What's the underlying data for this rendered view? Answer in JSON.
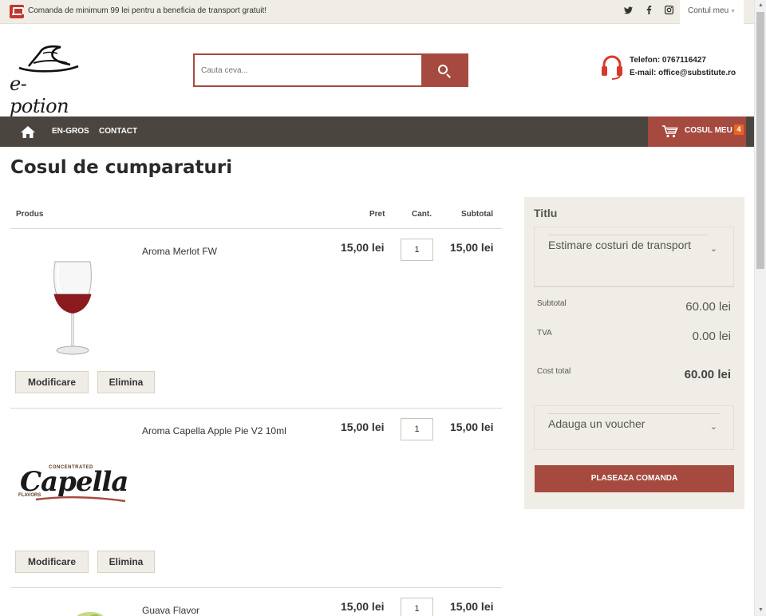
{
  "topbar": {
    "promo": "Comanda de minimum 99 lei pentru a beneficia de transport gratuit!",
    "social_icons": [
      "twitter-icon",
      "facebook-icon",
      "instagram-icon"
    ],
    "account_label": "Contul meu"
  },
  "header": {
    "logo_text": "e-potion",
    "search_placeholder": "Cauta ceva...",
    "phone_label": "Telefon: 0767116427",
    "email_label": "E-mail: office@substitute.ro"
  },
  "nav": {
    "items": [
      "EN-GROS",
      "CONTACT"
    ],
    "cart_label": "COSUL MEU",
    "cart_count": "4"
  },
  "page_title": "Cosul de cumparaturi",
  "table": {
    "col_product": "Produs",
    "col_price": "Pret",
    "col_qty": "Cant.",
    "col_subtotal": "Subtotal"
  },
  "items": [
    {
      "name": "Aroma Merlot FW",
      "price": "15,00 lei",
      "qty": "1",
      "subtotal": "15,00 lei",
      "image": "wine-glass"
    },
    {
      "name": "Aroma Capella Apple Pie V2 10ml",
      "price": "15,00 lei",
      "qty": "1",
      "subtotal": "15,00 lei",
      "image": "capella-logo"
    },
    {
      "name": "Guava Flavor",
      "price": "15,00 lei",
      "qty": "1",
      "subtotal": "15,00 lei",
      "image": "guava"
    }
  ],
  "buttons": {
    "edit": "Modificare",
    "remove": "Elimina"
  },
  "capella": {
    "top": "CONCENTRATED",
    "brand": "Capella",
    "bottom": "FLAVORS"
  },
  "summary": {
    "title": "Titlu",
    "shipping_estimate": "Estimare costuri de transport",
    "subtotal_label": "Subtotal",
    "subtotal_value": "60.00 lei",
    "tax_label": "TVA",
    "tax_value": "0.00 lei",
    "total_label": "Cost total",
    "total_value": "60.00 lei",
    "voucher_label": "Adauga un voucher",
    "checkout_label": "PLASEAZA COMANDA"
  },
  "colors": {
    "accent": "#a64a40",
    "nav_bg": "#4a463f",
    "panel_bg": "#efede6",
    "badge": "#e8661f"
  }
}
